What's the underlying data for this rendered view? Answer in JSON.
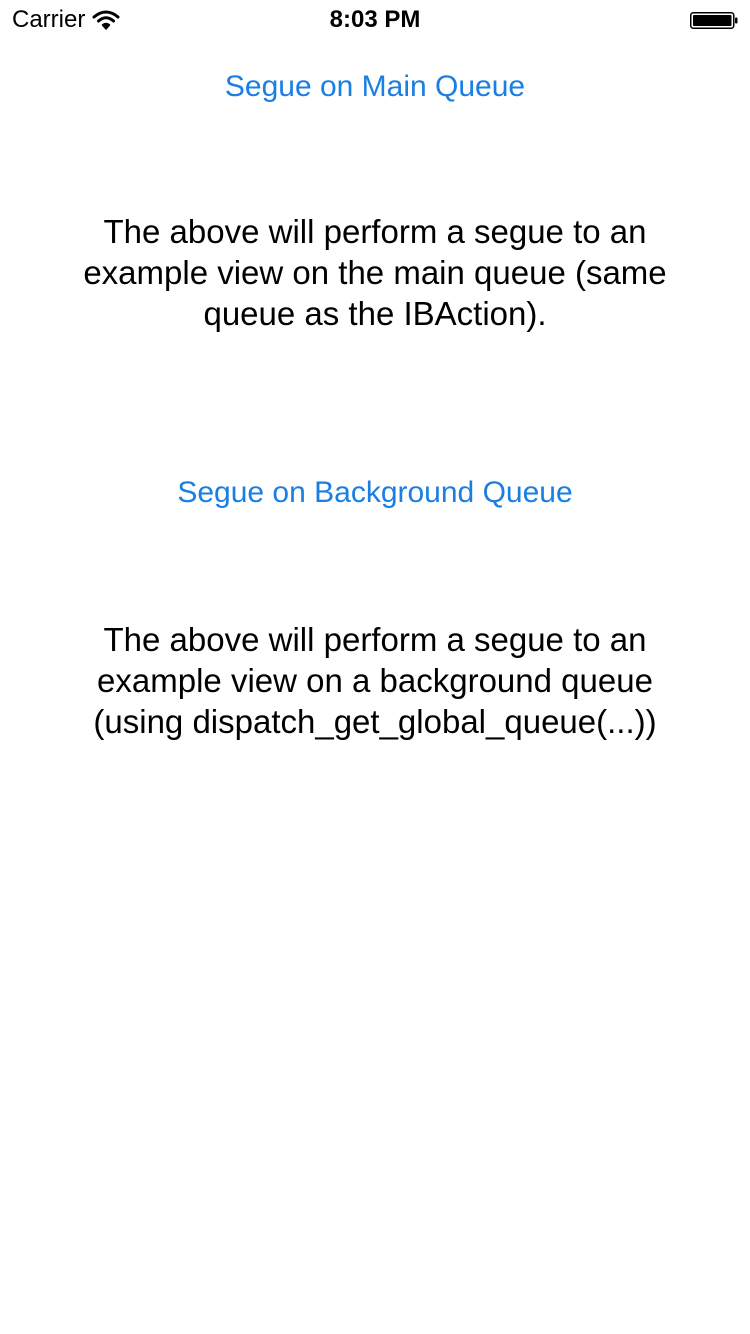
{
  "status_bar": {
    "carrier": "Carrier",
    "time": "8:03 PM",
    "wifi_icon": "wifi-icon",
    "battery_icon": "battery-icon",
    "battery_level": 1.0
  },
  "main": {
    "main_queue_button": "Segue on Main Queue",
    "main_queue_description": "The above will perform a segue to an example view on the main queue (same queue as the IBAction).",
    "background_queue_button": "Segue on Background Queue",
    "background_queue_description": "The above will perform a segue to an example view on a background queue (using dispatch_get_global_queue(...))"
  },
  "colors": {
    "link": "#1a7ee3",
    "text": "#000000",
    "background": "#ffffff"
  }
}
